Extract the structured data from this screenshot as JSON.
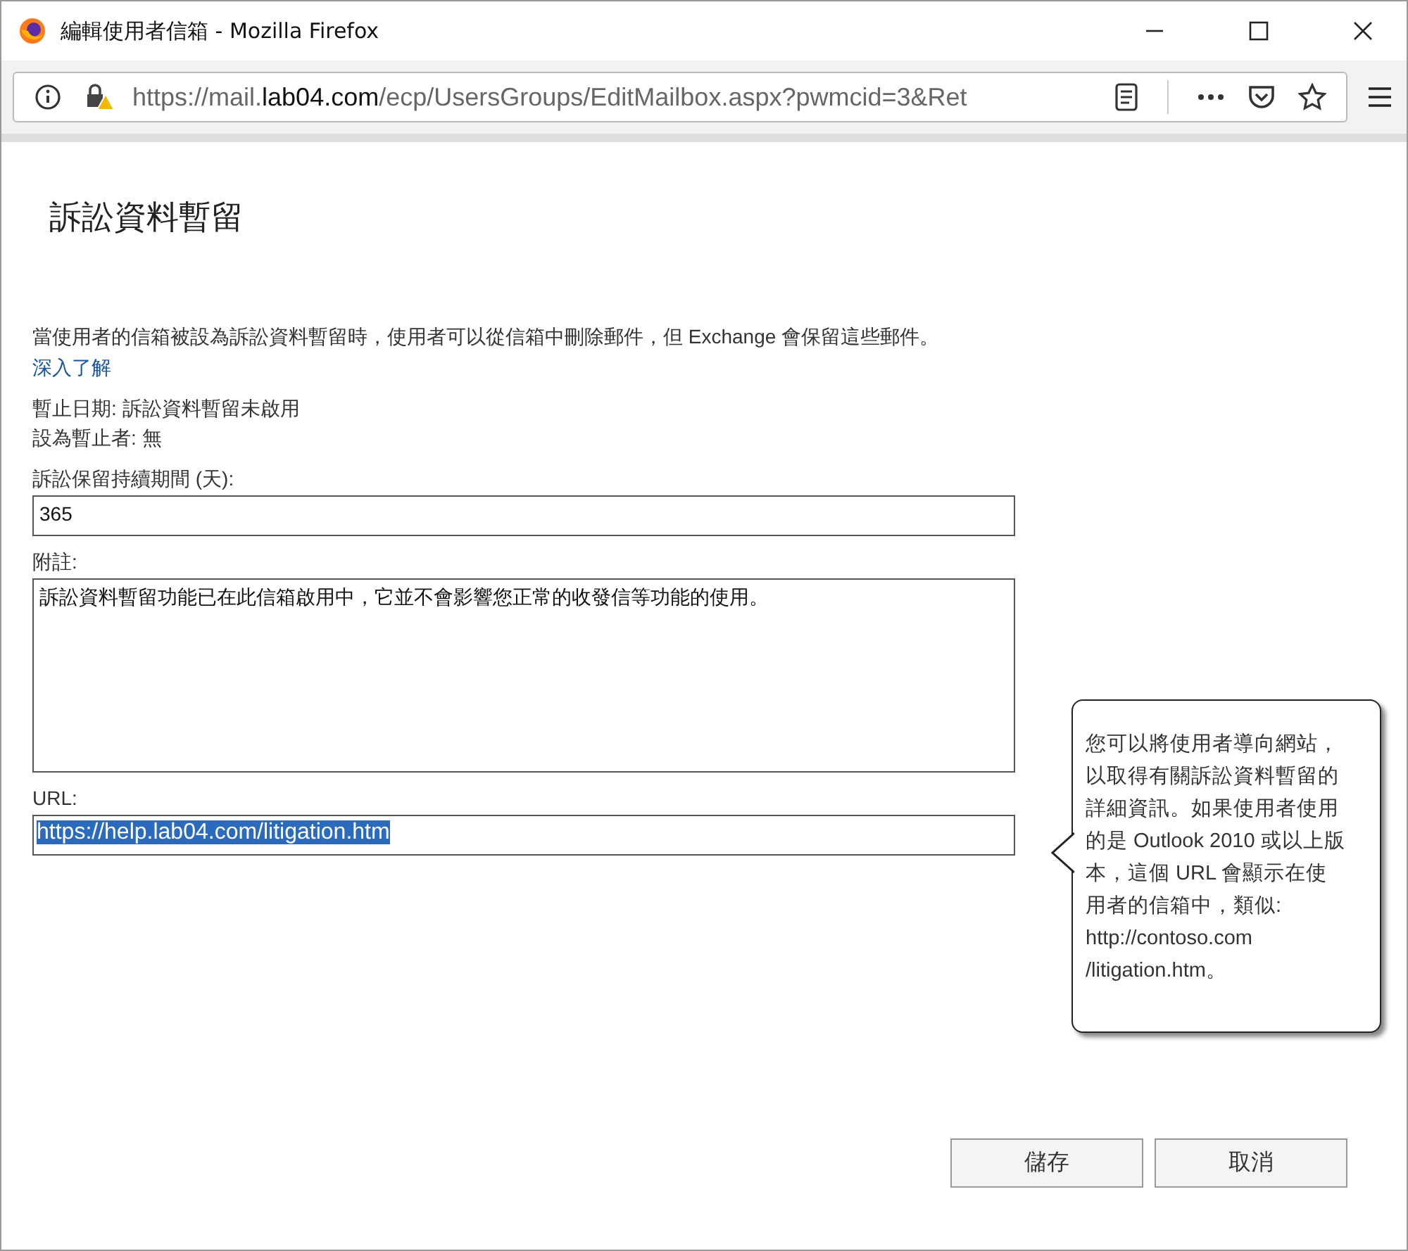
{
  "window": {
    "title": "編輯使用者信箱 - Mozilla Firefox"
  },
  "address_bar": {
    "url_prefix": "https://mail.",
    "url_domain": "lab04.com",
    "url_path": "/ecp/UsersGroups/EditMailbox.aspx?pwmcid=3&Ret"
  },
  "page": {
    "heading": "訴訟資料暫留",
    "description": "當使用者的信箱被設為訴訟資料暫留時，使用者可以從信箱中刪除郵件，但 Exchange 會保留這些郵件。",
    "learn_more_link": "深入了解",
    "status_lines": [
      "暫止日期: 訴訟資料暫留未啟用",
      "設為暫止者: 無"
    ],
    "duration": {
      "label": "訴訟保留持續期間 (天):",
      "value": "365"
    },
    "note": {
      "label": "附註:",
      "value": "訴訟資料暫留功能已在此信箱啟用中，它並不會影響您正常的收發信等功能的使用。"
    },
    "url": {
      "label": "URL:",
      "value": "https://help.lab04.com/litigation.htm",
      "selected": true
    },
    "tooltip": "您可以將使用者導向網站，以取得有關訴訟資料暫留的詳細資訊。如果使用者使用的是 Outlook 2010 或以上版本，這個 URL 會顯示在使用者的信箱中，類似: http://contoso.com /litigation.htm。",
    "buttons": [
      "儲存",
      "取消"
    ]
  }
}
